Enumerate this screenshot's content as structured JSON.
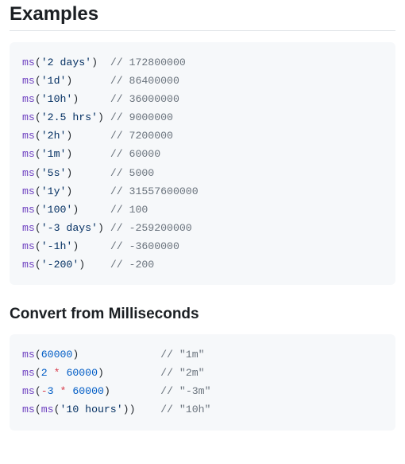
{
  "heading_examples": "Examples",
  "heading_convert": "Convert from Milliseconds",
  "block1": [
    {
      "fn": "ms",
      "arg_str": "'2 days'",
      "pad_after_call": "  ",
      "comment": "// 172800000"
    },
    {
      "fn": "ms",
      "arg_str": "'1d'",
      "pad_after_call": "      ",
      "comment": "// 86400000"
    },
    {
      "fn": "ms",
      "arg_str": "'10h'",
      "pad_after_call": "     ",
      "comment": "// 36000000"
    },
    {
      "fn": "ms",
      "arg_str": "'2.5 hrs'",
      "pad_after_call": " ",
      "comment": "// 9000000"
    },
    {
      "fn": "ms",
      "arg_str": "'2h'",
      "pad_after_call": "      ",
      "comment": "// 7200000"
    },
    {
      "fn": "ms",
      "arg_str": "'1m'",
      "pad_after_call": "      ",
      "comment": "// 60000"
    },
    {
      "fn": "ms",
      "arg_str": "'5s'",
      "pad_after_call": "      ",
      "comment": "// 5000"
    },
    {
      "fn": "ms",
      "arg_str": "'1y'",
      "pad_after_call": "      ",
      "comment": "// 31557600000"
    },
    {
      "fn": "ms",
      "arg_str": "'100'",
      "pad_after_call": "     ",
      "comment": "// 100"
    },
    {
      "fn": "ms",
      "arg_str": "'-3 days'",
      "pad_after_call": " ",
      "comment": "// -259200000"
    },
    {
      "fn": "ms",
      "arg_str": "'-1h'",
      "pad_after_call": "     ",
      "comment": "// -3600000"
    },
    {
      "fn": "ms",
      "arg_str": "'-200'",
      "pad_after_call": "    ",
      "comment": "// -200"
    }
  ],
  "block2": [
    {
      "fn": "ms",
      "tokens": [
        {
          "t": "num",
          "v": "60000"
        }
      ],
      "pad_after_call": "             ",
      "comment": "// \"1m\""
    },
    {
      "fn": "ms",
      "tokens": [
        {
          "t": "num",
          "v": "2"
        },
        {
          "t": "txt",
          "v": " "
        },
        {
          "t": "op",
          "v": "*"
        },
        {
          "t": "txt",
          "v": " "
        },
        {
          "t": "num",
          "v": "60000"
        }
      ],
      "pad_after_call": "         ",
      "comment": "// \"2m\""
    },
    {
      "fn": "ms",
      "tokens": [
        {
          "t": "op",
          "v": "-"
        },
        {
          "t": "num",
          "v": "3"
        },
        {
          "t": "txt",
          "v": " "
        },
        {
          "t": "op",
          "v": "*"
        },
        {
          "t": "txt",
          "v": " "
        },
        {
          "t": "num",
          "v": "60000"
        }
      ],
      "pad_after_call": "        ",
      "comment": "// \"-3m\""
    },
    {
      "fn": "ms",
      "tokens": [
        {
          "t": "fn",
          "v": "ms"
        },
        {
          "t": "txt",
          "v": "("
        },
        {
          "t": "str",
          "v": "'10 hours'"
        },
        {
          "t": "txt",
          "v": ")"
        }
      ],
      "pad_after_call": "    ",
      "comment": "// \"10h\""
    }
  ]
}
